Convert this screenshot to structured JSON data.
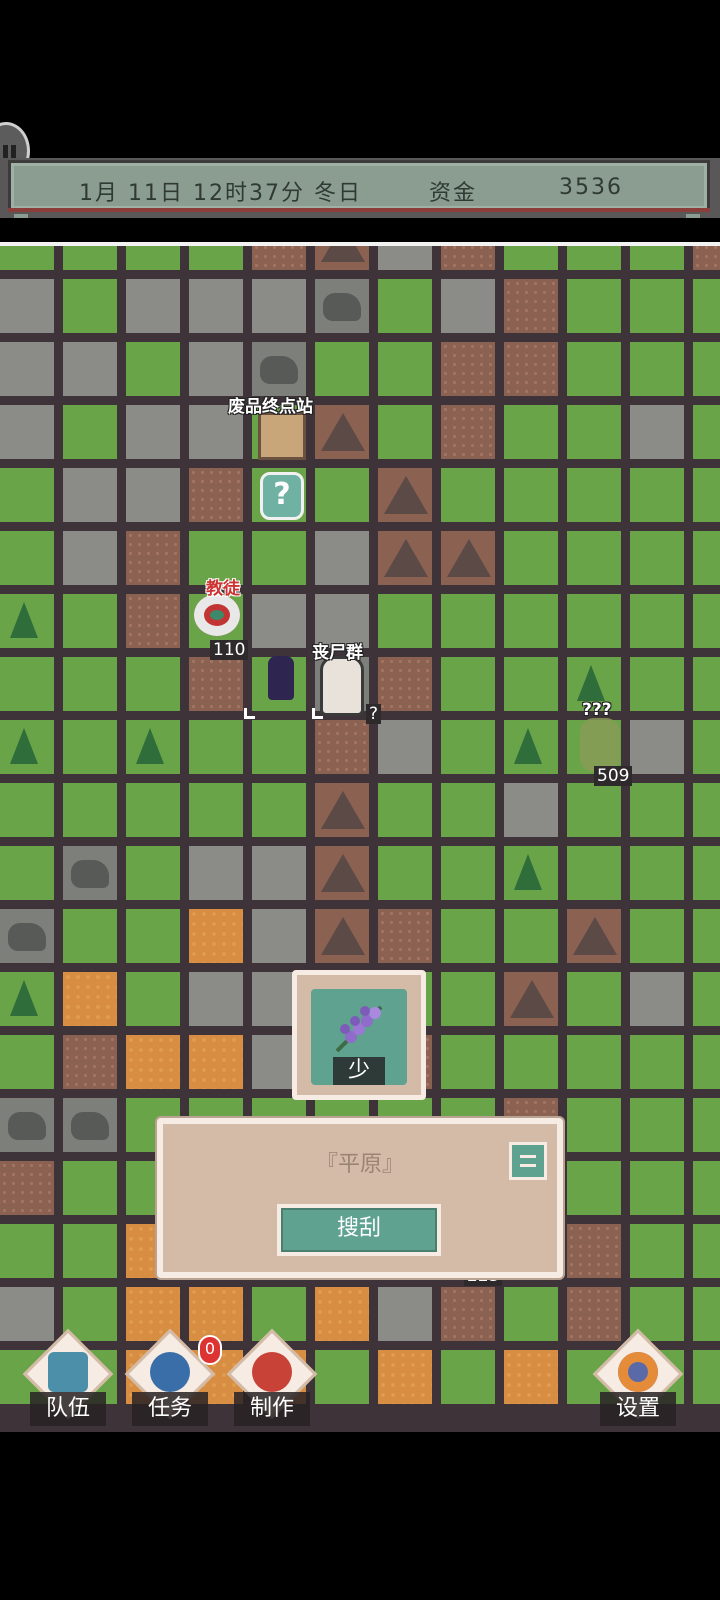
{
  "status_bar": {
    "date_time": "1月 11日 12时37分 冬日",
    "funds_label": "资金",
    "funds_value": "3536"
  },
  "map": {
    "labels": {
      "station": "废品终点站",
      "cultist": "教徒",
      "cultist_count": "110",
      "zombie_horde": "丧尸群",
      "zombie_count": "?",
      "unknown": "???",
      "unknown_count": "509",
      "bottom_count": "223"
    }
  },
  "item_card": {
    "item_icon": "lavender-icon",
    "quantity_label": "少"
  },
  "info_panel": {
    "title": "『平原』",
    "search_button": "搜刮"
  },
  "nav": {
    "team": "队伍",
    "tasks": "任务",
    "tasks_badge": "0",
    "craft": "制作",
    "settings": "设置"
  },
  "colors": {
    "grass": "#6aa448",
    "rock": "#8b8c88",
    "dirt": "#8b6152",
    "sand": "#d78e42",
    "panel": "#d3bba8",
    "accent": "#5fa290"
  }
}
